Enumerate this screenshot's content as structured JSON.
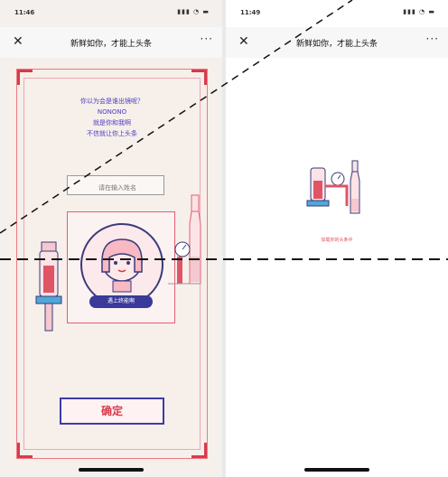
{
  "left_screen": {
    "status": {
      "time": "11:46",
      "icons": "▮▮▮ ◔ ▬"
    },
    "navbar": {
      "close_glyph": "✕",
      "title": "新鲜如你，才能上头条",
      "more_glyph": "···"
    },
    "poster": {
      "intro_lines": [
        "你以为会是谁出镜呢？",
        "NONONO",
        "就是你和我啊",
        "不信就让你上头条"
      ],
      "name_input": {
        "value": "",
        "placeholder": "请在输入姓名"
      },
      "portrait_label": "遇上终能啊",
      "confirm_label": "确定"
    }
  },
  "right_screen": {
    "status": {
      "time": "11:49",
      "icons": "▮▮▮ ◔ ▬"
    },
    "navbar": {
      "close_glyph": "✕",
      "title": "新鲜如你，才能上头条",
      "more_glyph": "···"
    },
    "loading_text": "加载你的头条中"
  },
  "colors": {
    "accent_red": "#d93a4c",
    "accent_blue": "#3f3aa8",
    "poster_bg": "#f6efea",
    "intro_text": "#4a3cc4"
  },
  "icons": [
    "close-icon",
    "more-icon",
    "signal-icon",
    "wifi-icon",
    "battery-icon"
  ]
}
